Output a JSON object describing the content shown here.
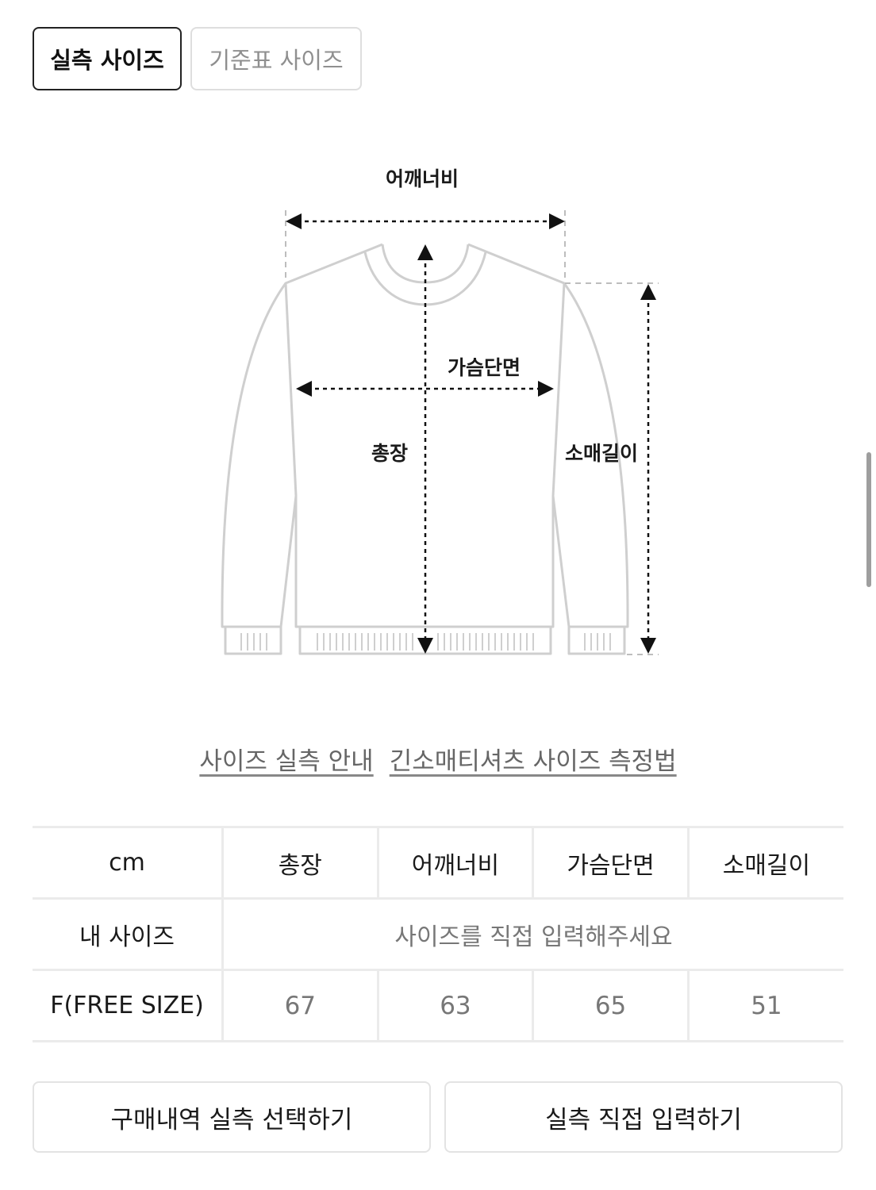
{
  "tabs": [
    {
      "label": "실측 사이즈",
      "active": true
    },
    {
      "label": "기준표 사이즈",
      "active": false
    }
  ],
  "diagram": {
    "labels": {
      "shoulder": "어깨너비",
      "chest": "가슴단면",
      "total_length": "총장",
      "sleeve": "소매길이"
    }
  },
  "guide_links": [
    "사이즈 실측 안내",
    "긴소매티셔츠 사이즈 측정법"
  ],
  "table": {
    "unit": "cm",
    "columns": [
      "총장",
      "어깨너비",
      "가슴단면",
      "소매길이"
    ],
    "my_size": {
      "label": "내 사이즈",
      "placeholder": "사이즈를 직접 입력해주세요"
    },
    "rows": [
      {
        "size": "F(FREE SIZE)",
        "values": [
          "67",
          "63",
          "65",
          "51"
        ]
      }
    ]
  },
  "actions": [
    "구매내역 실측 선택하기",
    "실측 직접 입력하기"
  ]
}
